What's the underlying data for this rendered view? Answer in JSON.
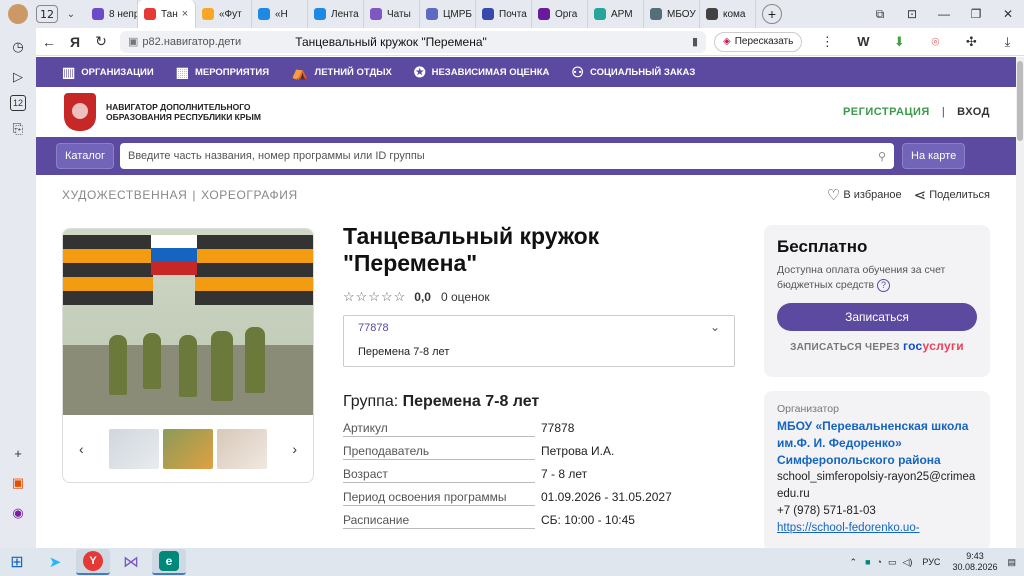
{
  "browser": {
    "tab_count": "12",
    "tabs": [
      {
        "label": "8 непр",
        "color": "#6a4cc9"
      },
      {
        "label": "Тан",
        "color": "#e53935",
        "active": true
      },
      {
        "label": "«Фут",
        "color": "#f9a825"
      },
      {
        "label": "«Н",
        "color": "#1e88e5"
      },
      {
        "label": "Лента",
        "color": "#1e88e5"
      },
      {
        "label": "Чаты",
        "color": "#7e57c2"
      },
      {
        "label": "ЦМРБ",
        "color": "#5c6bc0"
      },
      {
        "label": "Почта",
        "color": "#3949ab"
      },
      {
        "label": "Орга",
        "color": "#6a1b9a"
      },
      {
        "label": "АРМ",
        "color": "#26a69a"
      },
      {
        "label": "МБОУ",
        "color": "#546e7a"
      },
      {
        "label": "кома",
        "color": "#424242"
      }
    ],
    "url_domain": "р82.навигатор.дети",
    "page_title": "Танцевальный кружок \"Перемена\"",
    "retell_label": "Пересказать"
  },
  "site": {
    "nav": [
      {
        "label": "ОРГАНИЗАЦИИ",
        "icon": "building-icon"
      },
      {
        "label": "МЕРОПРИЯТИЯ",
        "icon": "calendar-icon"
      },
      {
        "label": "ЛЕТНИЙ ОТДЫХ",
        "icon": "tent-icon"
      },
      {
        "label": "НЕЗАВИСИМАЯ ОЦЕНКА",
        "icon": "medal-icon"
      },
      {
        "label": "СОЦИАЛЬНЫЙ ЗАКАЗ",
        "icon": "people-icon"
      }
    ],
    "brand": "НАВИГАТОР ДОПОЛНИТЕЛЬНОГО ОБРАЗОВАНИЯ РЕСПУБЛИКИ КРЫМ",
    "register": "РЕГИСТРАЦИЯ",
    "separator": "|",
    "login": "ВХОД",
    "catalog": "Каталог",
    "search_placeholder": "Введите часть названия, номер программы или ID группы",
    "on_map": "На карте"
  },
  "program": {
    "crumbs": [
      "ХУДОЖЕСТВЕННАЯ",
      "ХОРЕОГРАФИЯ"
    ],
    "crumb_sep": "|",
    "favorite": "В избраное",
    "share": "Поделиться",
    "title": "Танцевальный кружок \"Перемена\"",
    "rating_value": "0,0",
    "rating_count": "0 оценок",
    "stars": 0,
    "id": "77878",
    "id_group": "Перемена 7-8 лет",
    "group_label": "Группа:",
    "group_name": "Перемена 7-8 лет",
    "details": [
      {
        "k": "Артикул",
        "v": "77878"
      },
      {
        "k": "Преподаватель",
        "v": "Петрова И.А."
      },
      {
        "k": "Возраст",
        "v": "7 - 8 лет"
      },
      {
        "k": "Период освоения программы",
        "v": "01.09.2026 - 31.05.2027"
      },
      {
        "k": "Расписание",
        "v": "СБ: 10:00 - 10:45"
      }
    ]
  },
  "price": {
    "heading": "Бесплатно",
    "desc": "Доступна оплата обучения за счет бюджетных средств",
    "help": "?",
    "signup": "Записаться",
    "gos_prefix": "ЗАПИСАТЬСЯ ЧЕРЕЗ",
    "gos_a": "гос",
    "gos_b": "услуги"
  },
  "organizer": {
    "label": "Организатор",
    "name": "МБОУ «Перевальненская школа им.Ф. И. Федоренко» Симферопольского района",
    "email": "school_simferopolsiy-rayon25@crimeaedu.ru",
    "phone": "+7 (978) 571-81-03",
    "site": "https://school-fedorenko.uo-"
  },
  "taskbar": {
    "lang": "РУС",
    "time": "9:43",
    "date": "30.08.2026"
  }
}
